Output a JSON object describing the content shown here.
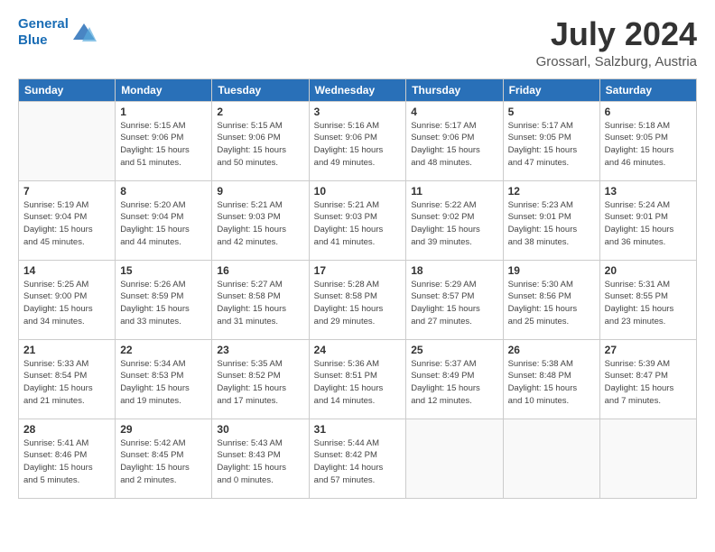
{
  "header": {
    "logo_line1": "General",
    "logo_line2": "Blue",
    "month": "July 2024",
    "location": "Grossarl, Salzburg, Austria"
  },
  "weekdays": [
    "Sunday",
    "Monday",
    "Tuesday",
    "Wednesday",
    "Thursday",
    "Friday",
    "Saturday"
  ],
  "weeks": [
    [
      {
        "day": "",
        "info": ""
      },
      {
        "day": "1",
        "info": "Sunrise: 5:15 AM\nSunset: 9:06 PM\nDaylight: 15 hours\nand 51 minutes."
      },
      {
        "day": "2",
        "info": "Sunrise: 5:15 AM\nSunset: 9:06 PM\nDaylight: 15 hours\nand 50 minutes."
      },
      {
        "day": "3",
        "info": "Sunrise: 5:16 AM\nSunset: 9:06 PM\nDaylight: 15 hours\nand 49 minutes."
      },
      {
        "day": "4",
        "info": "Sunrise: 5:17 AM\nSunset: 9:06 PM\nDaylight: 15 hours\nand 48 minutes."
      },
      {
        "day": "5",
        "info": "Sunrise: 5:17 AM\nSunset: 9:05 PM\nDaylight: 15 hours\nand 47 minutes."
      },
      {
        "day": "6",
        "info": "Sunrise: 5:18 AM\nSunset: 9:05 PM\nDaylight: 15 hours\nand 46 minutes."
      }
    ],
    [
      {
        "day": "7",
        "info": "Sunrise: 5:19 AM\nSunset: 9:04 PM\nDaylight: 15 hours\nand 45 minutes."
      },
      {
        "day": "8",
        "info": "Sunrise: 5:20 AM\nSunset: 9:04 PM\nDaylight: 15 hours\nand 44 minutes."
      },
      {
        "day": "9",
        "info": "Sunrise: 5:21 AM\nSunset: 9:03 PM\nDaylight: 15 hours\nand 42 minutes."
      },
      {
        "day": "10",
        "info": "Sunrise: 5:21 AM\nSunset: 9:03 PM\nDaylight: 15 hours\nand 41 minutes."
      },
      {
        "day": "11",
        "info": "Sunrise: 5:22 AM\nSunset: 9:02 PM\nDaylight: 15 hours\nand 39 minutes."
      },
      {
        "day": "12",
        "info": "Sunrise: 5:23 AM\nSunset: 9:01 PM\nDaylight: 15 hours\nand 38 minutes."
      },
      {
        "day": "13",
        "info": "Sunrise: 5:24 AM\nSunset: 9:01 PM\nDaylight: 15 hours\nand 36 minutes."
      }
    ],
    [
      {
        "day": "14",
        "info": "Sunrise: 5:25 AM\nSunset: 9:00 PM\nDaylight: 15 hours\nand 34 minutes."
      },
      {
        "day": "15",
        "info": "Sunrise: 5:26 AM\nSunset: 8:59 PM\nDaylight: 15 hours\nand 33 minutes."
      },
      {
        "day": "16",
        "info": "Sunrise: 5:27 AM\nSunset: 8:58 PM\nDaylight: 15 hours\nand 31 minutes."
      },
      {
        "day": "17",
        "info": "Sunrise: 5:28 AM\nSunset: 8:58 PM\nDaylight: 15 hours\nand 29 minutes."
      },
      {
        "day": "18",
        "info": "Sunrise: 5:29 AM\nSunset: 8:57 PM\nDaylight: 15 hours\nand 27 minutes."
      },
      {
        "day": "19",
        "info": "Sunrise: 5:30 AM\nSunset: 8:56 PM\nDaylight: 15 hours\nand 25 minutes."
      },
      {
        "day": "20",
        "info": "Sunrise: 5:31 AM\nSunset: 8:55 PM\nDaylight: 15 hours\nand 23 minutes."
      }
    ],
    [
      {
        "day": "21",
        "info": "Sunrise: 5:33 AM\nSunset: 8:54 PM\nDaylight: 15 hours\nand 21 minutes."
      },
      {
        "day": "22",
        "info": "Sunrise: 5:34 AM\nSunset: 8:53 PM\nDaylight: 15 hours\nand 19 minutes."
      },
      {
        "day": "23",
        "info": "Sunrise: 5:35 AM\nSunset: 8:52 PM\nDaylight: 15 hours\nand 17 minutes."
      },
      {
        "day": "24",
        "info": "Sunrise: 5:36 AM\nSunset: 8:51 PM\nDaylight: 15 hours\nand 14 minutes."
      },
      {
        "day": "25",
        "info": "Sunrise: 5:37 AM\nSunset: 8:49 PM\nDaylight: 15 hours\nand 12 minutes."
      },
      {
        "day": "26",
        "info": "Sunrise: 5:38 AM\nSunset: 8:48 PM\nDaylight: 15 hours\nand 10 minutes."
      },
      {
        "day": "27",
        "info": "Sunrise: 5:39 AM\nSunset: 8:47 PM\nDaylight: 15 hours\nand 7 minutes."
      }
    ],
    [
      {
        "day": "28",
        "info": "Sunrise: 5:41 AM\nSunset: 8:46 PM\nDaylight: 15 hours\nand 5 minutes."
      },
      {
        "day": "29",
        "info": "Sunrise: 5:42 AM\nSunset: 8:45 PM\nDaylight: 15 hours\nand 2 minutes."
      },
      {
        "day": "30",
        "info": "Sunrise: 5:43 AM\nSunset: 8:43 PM\nDaylight: 15 hours\nand 0 minutes."
      },
      {
        "day": "31",
        "info": "Sunrise: 5:44 AM\nSunset: 8:42 PM\nDaylight: 14 hours\nand 57 minutes."
      },
      {
        "day": "",
        "info": ""
      },
      {
        "day": "",
        "info": ""
      },
      {
        "day": "",
        "info": ""
      }
    ]
  ]
}
